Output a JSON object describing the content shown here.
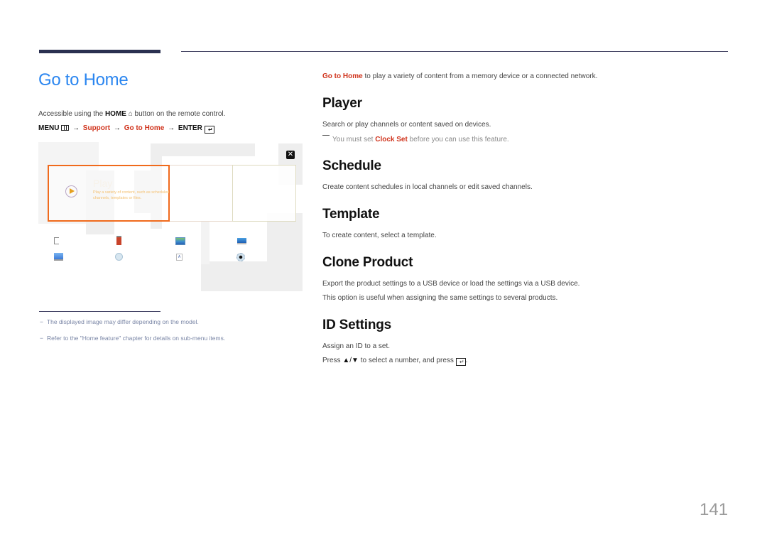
{
  "page": {
    "title": "Go to Home",
    "page_number": "141",
    "colors": {
      "title_blue": "#2b86f0",
      "highlight_red": "#d0331c",
      "header_bar": "#2a3050",
      "focus_orange": "#f06a1c"
    }
  },
  "left": {
    "access_prefix": "Accessible using the ",
    "access_key": "HOME",
    "access_icon": "home-icon",
    "access_suffix": " button on the remote control.",
    "menu_path": {
      "menu_label": "MENU",
      "menu_icon": "menu-icon",
      "arrow": "→",
      "step1": "Support",
      "step2": "Go to Home",
      "enter_label": "ENTER",
      "enter_icon": "enter-icon"
    },
    "screen": {
      "close_icon": "✕",
      "active_tile": {
        "title": "Play",
        "description": "Play a variety of content, such as scheduled channels, templates or files."
      },
      "apps_row1": [
        "usb-icon",
        "clone-icon",
        "template-icon",
        "laptop-icon"
      ],
      "apps_row2": [
        "monitor-icon",
        "clock-icon",
        "text-icon",
        "settings-icon"
      ]
    },
    "footnotes": [
      "The displayed image may differ depending on the model.",
      "Refer to the \"Home feature\" chapter for details on sub-menu items."
    ],
    "footnote_dash": "−"
  },
  "right": {
    "intro_highlight": "Go to Home",
    "intro_rest": " to play a variety of content from a memory device or a connected network.",
    "sections": {
      "player": {
        "heading": "Player",
        "text": "Search or play channels or content saved on devices.",
        "note_prefix": "You must set ",
        "note_highlight": "Clock Set",
        "note_suffix": " before you can use this feature."
      },
      "schedule": {
        "heading": "Schedule",
        "text": "Create content schedules in local channels or edit saved channels."
      },
      "template": {
        "heading": "Template",
        "text": "To create content, select a template."
      },
      "clone": {
        "heading": "Clone Product",
        "text1": "Export the product settings to a USB device or load the settings via a USB device.",
        "text2": "This option is useful when assigning the same settings to several products."
      },
      "id": {
        "heading": "ID Settings",
        "text1": "Assign an ID to a set.",
        "text2_prefix": "Press ",
        "text2_keys": "▲/▼",
        "text2_middle": " to select a number, and press ",
        "text2_suffix": "."
      }
    }
  }
}
